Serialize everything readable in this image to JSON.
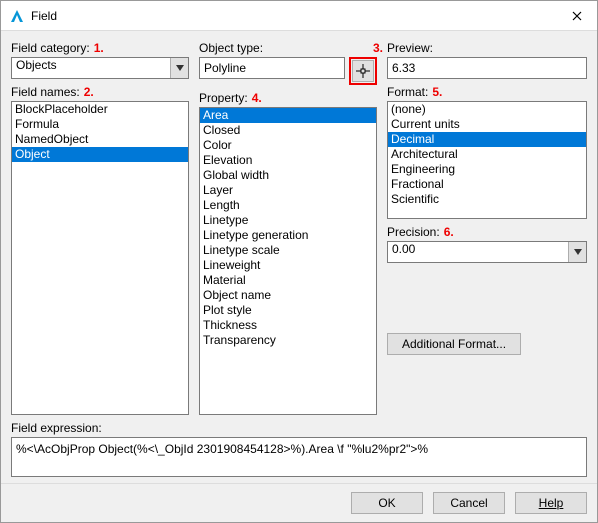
{
  "window": {
    "title": "Field"
  },
  "annotations": {
    "n1": "1.",
    "n2": "2.",
    "n3": "3.",
    "n4": "4.",
    "n5": "5.",
    "n6": "6."
  },
  "labels": {
    "field_category": "Field category:",
    "field_names": "Field names:",
    "object_type": "Object type:",
    "property": "Property:",
    "preview": "Preview:",
    "format": "Format:",
    "precision": "Precision:",
    "field_expression": "Field expression:",
    "additional_format": "Additional Format...",
    "ok": "OK",
    "cancel": "Cancel",
    "help": "Help"
  },
  "field_category": {
    "selected": "Objects"
  },
  "field_names": {
    "items": [
      "BlockPlaceholder",
      "Formula",
      "NamedObject",
      "Object"
    ],
    "selected": "Object"
  },
  "object_type": {
    "value": "Polyline"
  },
  "property": {
    "items": [
      "Area",
      "Closed",
      "Color",
      "Elevation",
      "Global width",
      "Layer",
      "Length",
      "Linetype",
      "Linetype generation",
      "Linetype scale",
      "Lineweight",
      "Material",
      "Object name",
      "Plot style",
      "Thickness",
      "Transparency"
    ],
    "selected": "Area"
  },
  "preview": {
    "value": "6.33"
  },
  "format": {
    "items": [
      "(none)",
      "Current units",
      "Decimal",
      "Architectural",
      "Engineering",
      "Fractional",
      "Scientific"
    ],
    "selected": "Decimal"
  },
  "precision": {
    "selected": "0.00"
  },
  "field_expression": {
    "value": "%<\\AcObjProp Object(%<\\_ObjId 2301908454128>%).Area \\f \"%lu2%pr2\">%"
  }
}
